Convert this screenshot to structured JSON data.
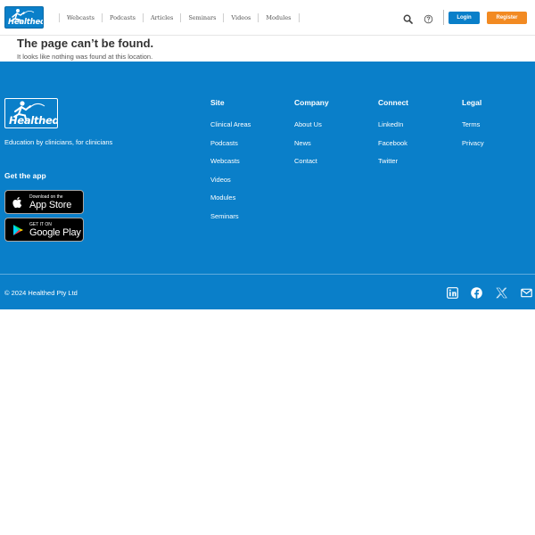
{
  "header": {
    "logo_text": "Healthed",
    "nav": [
      {
        "label": "Webcasts"
      },
      {
        "label": "Podcasts"
      },
      {
        "label": "Articles"
      },
      {
        "label": "Seminars"
      },
      {
        "label": "Videos"
      },
      {
        "label": "Modules"
      }
    ],
    "login_label": "Login",
    "register_label": "Register",
    "icons": {
      "search": "search-icon",
      "help": "help-icon"
    }
  },
  "not_found": {
    "title": "The page can’t be found.",
    "message": "It looks like nothing was found at this location."
  },
  "footer": {
    "logo_text": "Healthed",
    "tagline": "Education by clinicians, for clinicians",
    "get_app": "Get the app",
    "app_store": {
      "small": "Download on the",
      "big": "App Store"
    },
    "google_play": {
      "small": "GET IT ON",
      "big": "Google Play"
    },
    "columns": [
      {
        "heading": "Site",
        "links": [
          "Clinical Areas",
          "Podcasts",
          "Webcasts",
          "Videos",
          "Modules",
          "Seminars"
        ]
      },
      {
        "heading": "Company",
        "links": [
          "About Us",
          "News",
          "Contact"
        ]
      },
      {
        "heading": "Connect",
        "links": [
          "LinkedIn",
          "Facebook",
          "Twitter"
        ]
      },
      {
        "heading": "Legal",
        "links": [
          "Terms",
          "Privacy"
        ]
      }
    ],
    "copyright": "© 2024 Healthed Pty Ltd",
    "social_icons": [
      "linkedin-icon",
      "facebook-icon",
      "x-icon",
      "mail-icon"
    ]
  },
  "colors": {
    "brand_blue": "#0a7fc9",
    "register_orange": "#f28a22",
    "footer_text": "#ffffff"
  }
}
